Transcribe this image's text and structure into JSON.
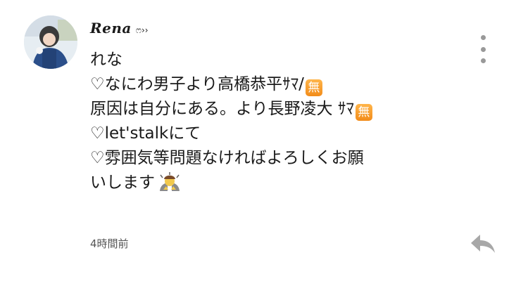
{
  "post": {
    "username": "Rena",
    "username_deco": "ෆ››",
    "message": {
      "line1": "れな",
      "line2": "♡なにわ男子より高橋恭平ｻﾏ/",
      "line2_badge": "無",
      "line3": "原因は自分にある。より長野凌大 ｻﾏ",
      "line3_badge": "無",
      "line4": "♡let'stalkにて",
      "line5": "♡雰囲気等問題なければよろしくお願",
      "line6": "いします"
    },
    "timestamp": "4時間前",
    "icons": {
      "menu": "more-vertical-icon",
      "reply": "reply-icon",
      "bow": "person-bowing-icon"
    },
    "colors": {
      "badge": "#f5a030",
      "meta_gray": "#999999",
      "text": "#1a1a1a"
    }
  }
}
